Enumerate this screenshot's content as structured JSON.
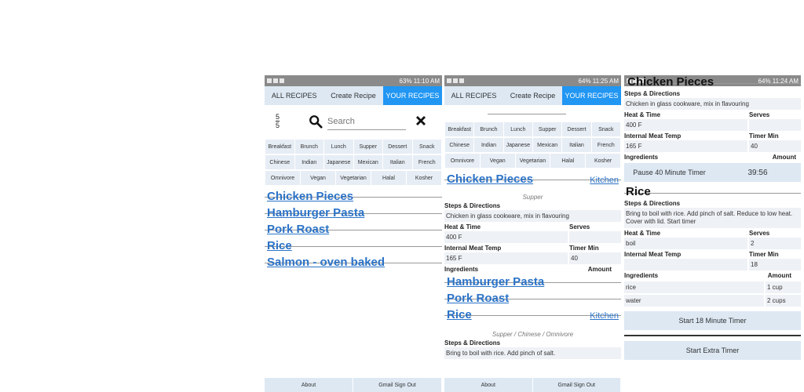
{
  "status": {
    "p1": {
      "right": "63% 11:10 AM"
    },
    "p2": {
      "right": "64% 11:25 AM"
    },
    "p3": {
      "right": "64% 11:24 AM"
    }
  },
  "tabs": [
    "ALL RECIPES",
    "Create Recipe",
    "YOUR RECIPES"
  ],
  "search": {
    "count_top": "5",
    "count_bottom": "5",
    "placeholder": "Search"
  },
  "filters": {
    "row1": [
      "Breakfast",
      "Brunch",
      "Lunch",
      "Supper",
      "Dessert",
      "Snack"
    ],
    "row2": [
      "Chinese",
      "Indian",
      "Japanese",
      "Mexican",
      "Italian",
      "French"
    ],
    "row3": [
      "Omnivore",
      "Vegan",
      "Vegetarian",
      "Halal",
      "Kosher"
    ]
  },
  "recipes": [
    "Chicken Pieces",
    "Hamburger Pasta",
    "Pork Roast",
    "Rice",
    "Salmon - oven baked"
  ],
  "footer": {
    "about": "About",
    "signout": "Gmail Sign Out"
  },
  "detail": {
    "kitchen": "Kitchen",
    "chicken": {
      "title": "Chicken Pieces",
      "category": "Supper",
      "steps_label": "Steps & Directions",
      "steps": "Chicken in glass cookware, mix in flavouring",
      "heat_label": "Heat & Time",
      "serves_label": "Serves",
      "heat": "400 F",
      "serves": "",
      "meat_label": "Internal Meat Temp",
      "timer_label": "Timer Min",
      "meat": "165 F",
      "timer": "40",
      "ingredients_label": "Ingredients",
      "amount_label": "Amount"
    },
    "rice": {
      "title": "Rice",
      "category": "Supper / Chinese / Omnivore",
      "steps_label": "Steps & Directions",
      "steps_short": "Bring to boil with rice. Add pinch of salt.",
      "steps": "Bring to boil with rice. Add pinch of salt. Reduce to low heat. Cover with lid. Start timer",
      "heat_label": "Heat & Time",
      "serves_label": "Serves",
      "heat": "boil",
      "serves": "2",
      "meat_label": "Internal Meat Temp",
      "timer_label": "Timer Min",
      "meat": "",
      "timer": "18",
      "ingredients_label": "Ingredients",
      "amount_label": "Amount",
      "ingredients": [
        {
          "name": "rice",
          "amount": "1 cup"
        },
        {
          "name": "water",
          "amount": "2 cups"
        }
      ]
    }
  },
  "timers": {
    "pause_label": "Pause 40 Minute Timer",
    "countdown": "39:56",
    "start_label": "Start 18 Minute Timer",
    "extra_label": "Start Extra Timer"
  },
  "colors": {
    "accent": "#2196f3",
    "link": "#2b73c7",
    "tabbar": "#dde8f3"
  }
}
